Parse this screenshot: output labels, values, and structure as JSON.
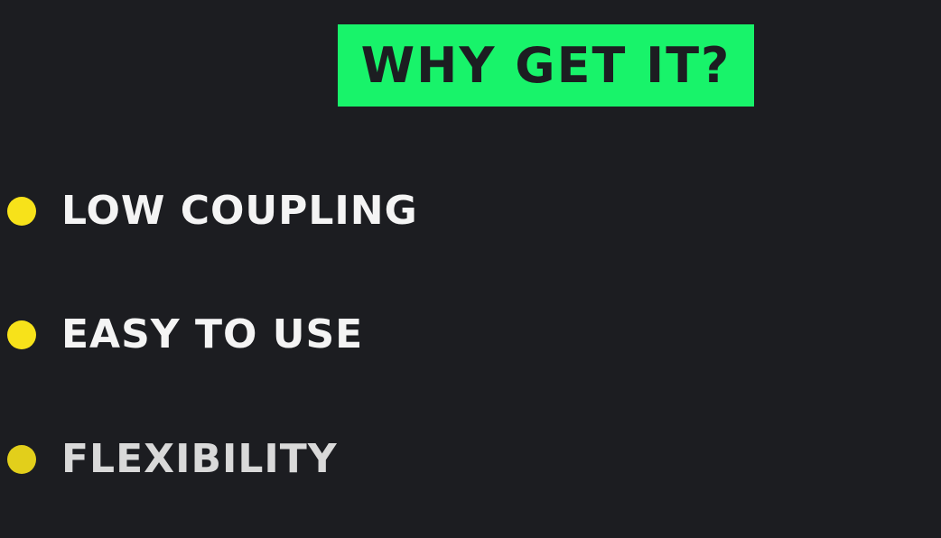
{
  "title": "WHY GET IT?",
  "bullets": [
    {
      "label": "LOW COUPLING"
    },
    {
      "label": "EASY TO USE"
    },
    {
      "label": "FLEXIBILITY"
    }
  ],
  "colors": {
    "background": "#1c1d21",
    "title_background": "#18f36a",
    "title_text": "#1c1d21",
    "bullet_dot": "#f7e21a",
    "bullet_text": "#f4f4f4"
  }
}
